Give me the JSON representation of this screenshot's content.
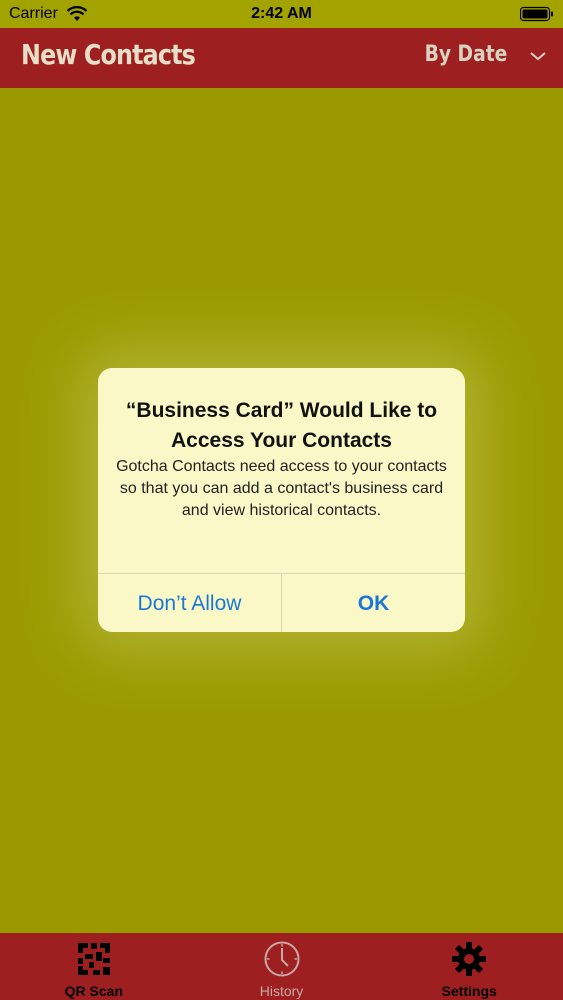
{
  "status_bar": {
    "carrier": "Carrier",
    "time": "2:42 AM",
    "wifi_icon": "wifi-icon",
    "battery_icon": "battery-icon"
  },
  "nav": {
    "title": "New Contacts",
    "sort_label": "By Date",
    "sort_icon": "chevron-down-icon"
  },
  "alert": {
    "title": "“Business Card” Would Like to Access Your Contacts",
    "message": "Gotcha Contacts need access to your contacts so that you can add a contact's business card and view historical contacts.",
    "buttons": {
      "deny": "Don’t Allow",
      "allow": "OK"
    }
  },
  "tabs": [
    {
      "label": "QR Scan",
      "icon": "qr-code-icon",
      "state": "active"
    },
    {
      "label": "History",
      "icon": "clock-icon",
      "state": "inactive"
    },
    {
      "label": "Settings",
      "icon": "gear-icon",
      "state": "active"
    }
  ],
  "colors": {
    "background": "#9a9a00",
    "bars": "#9d1f1f",
    "alert_bg": "#fbf8c8",
    "button_blue": "#1a78d4"
  }
}
